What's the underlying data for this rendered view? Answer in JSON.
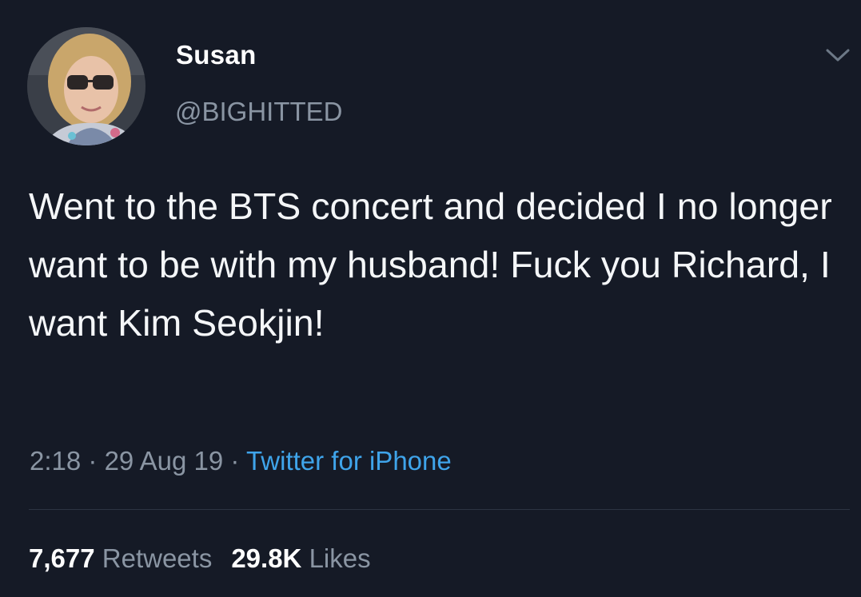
{
  "user": {
    "display_name": "Susan",
    "handle": "@BIGHITTED",
    "avatar_icon": "profile-photo-avatar"
  },
  "tweet": {
    "text": "Went to the BTS concert and decided I no longer want to be with my husband! Fuck you Richard, I want Kim Seokjin!"
  },
  "meta": {
    "time": "2:18",
    "separator": " · ",
    "date": "29 Aug 19",
    "source": "Twitter for iPhone"
  },
  "stats": {
    "retweets_count": "7,677",
    "retweets_label": "Retweets",
    "likes_count": "29.8K",
    "likes_label": "Likes"
  },
  "colors": {
    "background": "#151a26",
    "text": "#f4f6f8",
    "muted": "#8a95a3",
    "link": "#3fa4ea"
  },
  "icons": {
    "menu": "chevron-down-icon"
  }
}
